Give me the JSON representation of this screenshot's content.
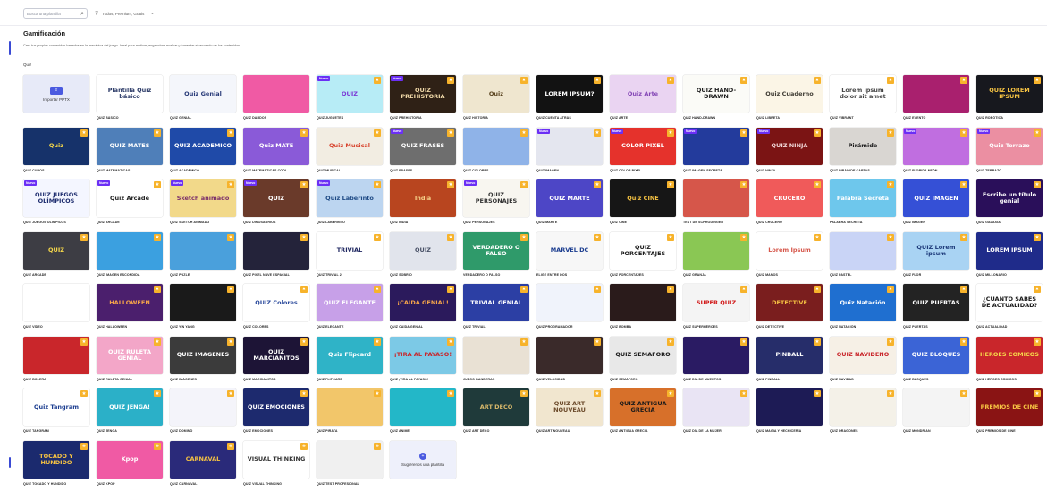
{
  "search": {
    "placeholder": "Busca una plantilla"
  },
  "filter": {
    "label": "Todos, Premium, Gratis"
  },
  "page": {
    "title": "Gamificación",
    "description": "Crea tus propios contenidos basados en la mecánica del juego. Ideal para motivar, enganchar, evaluar y fomentar el recuerdo de los contenidos.",
    "section": "Quiz"
  },
  "cards": [
    {
      "label": "",
      "thumb": "Importar PPTX",
      "bg": "#e7eaf8",
      "fg": "#3f4fd9",
      "kind": "upload"
    },
    {
      "label": "QUIZ BÁSICO",
      "thumb": "Plantilla Quiz básico",
      "bg": "#ffffff",
      "fg": "#2b3a67"
    },
    {
      "label": "QUIZ GENIAL",
      "thumb": "Quiz Genial",
      "bg": "#f4f6fb",
      "fg": "#283a78"
    },
    {
      "label": "QUIZ DARDOS",
      "thumb": "",
      "bg": "#f05aa4",
      "fg": "#ffffff"
    },
    {
      "label": "QUIZ JUGUETES",
      "thumb": "QUIZ",
      "bg": "#b7ecf6",
      "fg": "#7b39d6",
      "new": true,
      "star": true
    },
    {
      "label": "QUIZ PREHISTORIA",
      "thumb": "QUIZ PREHISTORIA",
      "bg": "#2f2116",
      "fg": "#f1d9a8",
      "new": true,
      "star": true
    },
    {
      "label": "QUIZ HISTORIA",
      "thumb": "Quiz",
      "bg": "#efe6cf",
      "fg": "#5a4420",
      "star": true
    },
    {
      "label": "QUIZ CUENTA ATRÁS",
      "thumb": "LOREM IPSUM?",
      "bg": "#121212",
      "fg": "#ffffff",
      "star": true
    },
    {
      "label": "QUIZ ARTE",
      "thumb": "Quiz Arte",
      "bg": "#ead4f2",
      "fg": "#8447b6",
      "star": true
    },
    {
      "label": "QUIZ HAND-DRAWN",
      "thumb": "QUIZ HAND-DRAWN",
      "bg": "#fbfbf7",
      "fg": "#1e1e1e",
      "star": true
    },
    {
      "label": "QUIZ LIBRETA",
      "thumb": "Quiz Cuaderno",
      "bg": "#fbf5e6",
      "fg": "#403d35",
      "star": true
    },
    {
      "label": "QUIZ VIBRANT",
      "thumb": "Lorem ipsum dolor sit amet",
      "bg": "#ffffff",
      "fg": "#444444",
      "star": true
    },
    {
      "label": "QUIZ EVENTO",
      "thumb": "",
      "bg": "#a9206e",
      "fg": "#ffffff",
      "star": true
    },
    {
      "label": "QUIZ ROBÓTICA",
      "thumb": "QUIZ LOREM IPSUM",
      "bg": "#17181e",
      "fg": "#f6c343",
      "star": true
    },
    {
      "label": "QUIZ CUBOS",
      "thumb": "Quiz",
      "bg": "#16326a",
      "fg": "#f6d84a",
      "star": true
    },
    {
      "label": "QUIZ MATEMÁTICAS",
      "thumb": "QUIZ MATES",
      "bg": "#4f7fb9",
      "fg": "#ffffff",
      "star": true
    },
    {
      "label": "QUIZ ACADÉMICO",
      "thumb": "QUIZ ACADÉMICO",
      "bg": "#1f4aa8",
      "fg": "#ffffff",
      "star": true
    },
    {
      "label": "QUIZ MATEMÁTICAS COOL",
      "thumb": "Quiz MATE",
      "bg": "#8a5ad8",
      "fg": "#ffffff",
      "star": true
    },
    {
      "label": "QUIZ MUSICAL",
      "thumb": "Quiz Musical",
      "bg": "#f2ede2",
      "fg": "#d8452f",
      "star": true
    },
    {
      "label": "QUIZ FRASES",
      "thumb": "QUIZ FRASES",
      "bg": "#6e6e6e",
      "fg": "#ffffff",
      "new": true,
      "star": true
    },
    {
      "label": "QUIZ COLORES",
      "thumb": "",
      "bg": "#8fb3e8",
      "fg": "#ffffff",
      "star": true
    },
    {
      "label": "QUIZ IMAGEN",
      "thumb": "",
      "bg": "#e4e6ef",
      "fg": "#333333",
      "new": true,
      "star": true
    },
    {
      "label": "QUIZ COLOR PIXEL",
      "thumb": "COLOR PIXEL",
      "bg": "#e5322c",
      "fg": "#ffffff",
      "new": true,
      "star": true
    },
    {
      "label": "QUIZ IMAGEN SECRETA",
      "thumb": "",
      "bg": "#233b9c",
      "fg": "#ffffff",
      "new": true,
      "star": true
    },
    {
      "label": "QUIZ NINJA",
      "thumb": "QUIZ NINJA",
      "bg": "#7b1414",
      "fg": "#f0d5d5",
      "new": true,
      "star": true
    },
    {
      "label": "QUIZ PIRÁMIDE CARTAS",
      "thumb": "Pirámide",
      "bg": "#d9d6d2",
      "fg": "#1a1a1a",
      "star": true
    },
    {
      "label": "QUIZ FLORIDA NEÓN",
      "thumb": "",
      "bg": "#c06ee0",
      "fg": "#ffffff",
      "new": true,
      "star": true
    },
    {
      "label": "QUIZ TERRAZO",
      "thumb": "Quiz Terrazo",
      "bg": "#eb8fa2",
      "fg": "#ffffff",
      "new": true,
      "star": true
    },
    {
      "label": "QUIZ JUEGOS OLÍMPICOS",
      "thumb": "QUIZ JUEGOS OLÍMPICOS",
      "bg": "#f4f6ff",
      "fg": "#1d2c6e",
      "new": true
    },
    {
      "label": "QUIZ ARCADE",
      "thumb": "Quiz Arcade",
      "bg": "#ffffff",
      "fg": "#222222",
      "new": true,
      "star": true
    },
    {
      "label": "QUIZ SKETCH ANIMADO",
      "thumb": "Sketch animado",
      "bg": "#f2d98a",
      "fg": "#7a2e6a",
      "new": true,
      "star": true
    },
    {
      "label": "QUIZ DINOSAURIOS",
      "thumb": "QUIZ",
      "bg": "#6a3a2a",
      "fg": "#ffffff",
      "new": true,
      "star": true
    },
    {
      "label": "QUIZ LABERINTO",
      "thumb": "Quiz Laberinto",
      "bg": "#bcd5f0",
      "fg": "#1e4a85",
      "new": true,
      "star": true
    },
    {
      "label": "QUIZ INDIA",
      "thumb": "India",
      "bg": "#b8451f",
      "fg": "#f6d28a",
      "star": true
    },
    {
      "label": "QUIZ PERSONAJES",
      "thumb": "QUIZ PERSONAJES",
      "bg": "#f8f6f0",
      "fg": "#333333",
      "new": true,
      "star": true
    },
    {
      "label": "QUIZ MARTE",
      "thumb": "QUIZ MARTE",
      "bg": "#4d46c6",
      "fg": "#ffffff",
      "star": true
    },
    {
      "label": "QUIZ CINE",
      "thumb": "Quiz CINE",
      "bg": "#161616",
      "fg": "#f6c343",
      "star": true
    },
    {
      "label": "TEST DE SCHRÖDINGER",
      "thumb": "",
      "bg": "#d6564a",
      "fg": "#ffffff",
      "star": true
    },
    {
      "label": "QUIZ CRUCERO",
      "thumb": "CRUCERO",
      "bg": "#f05a5a",
      "fg": "#ffffff",
      "star": true
    },
    {
      "label": "PALABRA SECRETA",
      "thumb": "Palabra Secreta",
      "bg": "#6ec7ec",
      "fg": "#ffffff",
      "star": true
    },
    {
      "label": "QUIZ IMAGEN",
      "thumb": "QUIZ IMAGEN",
      "bg": "#3550d6",
      "fg": "#ffffff",
      "star": true
    },
    {
      "label": "QUIZ GALAXIA",
      "thumb": "Escribe un título genial",
      "bg": "#2a0f5a",
      "fg": "#ffffff",
      "star": true
    },
    {
      "label": "QUIZ ARCADE",
      "thumb": "QUIZ",
      "bg": "#3d3d44",
      "fg": "#f6d84a",
      "star": true
    },
    {
      "label": "QUIZ IMAGEN ESCONDIDA",
      "thumb": "",
      "bg": "#3ba0e0",
      "fg": "#ffffff",
      "star": true
    },
    {
      "label": "QUIZ PUZLE",
      "thumb": "",
      "bg": "#4aa0dc",
      "fg": "#ffffff",
      "star": true
    },
    {
      "label": "QUIZ PIXEL NAVE ESPACIAL",
      "thumb": "",
      "bg": "#24233a",
      "fg": "#ffffff",
      "star": true
    },
    {
      "label": "QUIZ TRIVIAL 2",
      "thumb": "TRIVIAL",
      "bg": "#ffffff",
      "fg": "#1e2660",
      "star": true
    },
    {
      "label": "QUIZ SOBRIO",
      "thumb": "QUIZ",
      "bg": "#e1e4ec",
      "fg": "#485066",
      "star": true
    },
    {
      "label": "VERDADERO O FALSO",
      "thumb": "VERDADERO O FALSO",
      "bg": "#2f9a6a",
      "fg": "#ffffff",
      "star": true
    },
    {
      "label": "ELIGE ENTRE DOS",
      "thumb": "MARVEL DC",
      "bg": "#f7f7f7",
      "fg": "#1a3c8f",
      "star": true
    },
    {
      "label": "QUIZ PORCENTAJES",
      "thumb": "QUIZ PORCENTAJES",
      "bg": "#ffffff",
      "fg": "#1a1a1a",
      "star": true
    },
    {
      "label": "QUIZ GRANJA",
      "thumb": "",
      "bg": "#8ac754",
      "fg": "#ffffff",
      "star": true
    },
    {
      "label": "QUIZ MANOS",
      "thumb": "Lorem Ipsum",
      "bg": "#ffffff",
      "fg": "#d6564a",
      "star": true
    },
    {
      "label": "QUIZ PASTEL",
      "thumb": "",
      "bg": "#c9d4f6",
      "fg": "#333333",
      "star": true
    },
    {
      "label": "QUIZ FLOR",
      "thumb": "QUIZ Lorem ipsum",
      "bg": "#a9d3f3",
      "fg": "#1d3a7a",
      "star": true
    },
    {
      "label": "QUIZ MILLONARIO",
      "thumb": "LOREM IPSUM",
      "bg": "#1f2b8a",
      "fg": "#ffffff",
      "star": true
    },
    {
      "label": "QUIZ VÍDEO",
      "thumb": "",
      "bg": "#ffffff",
      "fg": "#222222"
    },
    {
      "label": "QUIZ HALLOWEEN",
      "thumb": "HALLOWEEN",
      "bg": "#4b1f6d",
      "fg": "#f6a54a",
      "star": true
    },
    {
      "label": "QUIZ YIN YANG",
      "thumb": "",
      "bg": "#1a1a1a",
      "fg": "#ffffff",
      "star": true
    },
    {
      "label": "QUIZ COLORES",
      "thumb": "QUIZ Colores",
      "bg": "#ffffff",
      "fg": "#2b4a9c",
      "star": true
    },
    {
      "label": "QUIZ ELEGANTE",
      "thumb": "QUIZ ELEGANTE",
      "bg": "#c7a0e8",
      "fg": "#ffffff",
      "star": true
    },
    {
      "label": "QUIZ CAÍDA GENIAL",
      "thumb": "¡CAÍDA GENIAL!",
      "bg": "#2b1a5c",
      "fg": "#f6a54a",
      "star": true
    },
    {
      "label": "QUIZ TRIVIAL",
      "thumb": "TRIVIAL GENIAL",
      "bg": "#2c3fa4",
      "fg": "#ffffff",
      "star": true
    },
    {
      "label": "QUIZ PROGRAMADOR",
      "thumb": "",
      "bg": "#f0f3fb",
      "fg": "#1b2a6b",
      "star": true
    },
    {
      "label": "QUIZ BOMBA",
      "thumb": "",
      "bg": "#2a1b1b",
      "fg": "#ffffff",
      "star": true
    },
    {
      "label": "QUIZ SUPERHÉROES",
      "thumb": "SUPER QUIZ",
      "bg": "#f4f4f4",
      "fg": "#d11a1a",
      "star": true
    },
    {
      "label": "QUIZ DETECTIVE",
      "thumb": "DETECTIVE",
      "bg": "#7a1e1e",
      "fg": "#f6c343",
      "star": true
    },
    {
      "label": "QUIZ NATACIÓN",
      "thumb": "Quiz Natación",
      "bg": "#1f6fd0",
      "fg": "#ffffff",
      "star": true
    },
    {
      "label": "QUIZ PUERTAS",
      "thumb": "QUIZ PUERTAS",
      "bg": "#232323",
      "fg": "#ffffff",
      "star": true
    },
    {
      "label": "QUIZ ACTUALIDAD",
      "thumb": "¿CUÁNTO SABES DE ACTUALIDAD?",
      "bg": "#ffffff",
      "fg": "#1a1a1a",
      "star": true
    },
    {
      "label": "QUIZ BOLERA",
      "thumb": "",
      "bg": "#c9262b",
      "fg": "#ffffff",
      "star": true
    },
    {
      "label": "QUIZ RULETA GENIAL",
      "thumb": "QUIZ RULETA GENIAL",
      "bg": "#f3a6c8",
      "fg": "#ffffff",
      "star": true
    },
    {
      "label": "QUIZ IMÁGENES",
      "thumb": "QUIZ IMÁGENES",
      "bg": "#3b3b3b",
      "fg": "#ffffff",
      "star": true
    },
    {
      "label": "QUIZ MARCIANITOS",
      "thumb": "QUIZ MARCIANITOS",
      "bg": "#1d1436",
      "fg": "#ffffff",
      "star": true
    },
    {
      "label": "QUIZ FLIPCARD",
      "thumb": "Quiz Flipcard",
      "bg": "#2fb3c7",
      "fg": "#ffffff",
      "star": true
    },
    {
      "label": "QUIZ ¡TIRA AL PAYASO!",
      "thumb": "¡TIRA AL PAYASO!",
      "bg": "#7cc9e6",
      "fg": "#c9262b",
      "star": true
    },
    {
      "label": "JUEGO BANDERAS",
      "thumb": "",
      "bg": "#e9e1d4",
      "fg": "#333333",
      "star": true
    },
    {
      "label": "QUIZ VELOCIDAD",
      "thumb": "",
      "bg": "#3a2a2a",
      "fg": "#ffffff",
      "star": true
    },
    {
      "label": "QUIZ SEMÁFORO",
      "thumb": "QUIZ SEMÁFORO",
      "bg": "#e8e8e8",
      "fg": "#1a1a1a",
      "star": true
    },
    {
      "label": "QUIZ DÍA DE MUERTOS",
      "thumb": "",
      "bg": "#2a1b63",
      "fg": "#f6c343",
      "star": true
    },
    {
      "label": "QUIZ PINBALL",
      "thumb": "PINBALL",
      "bg": "#262d6a",
      "fg": "#ffffff",
      "star": true
    },
    {
      "label": "QUIZ NAVIDAD",
      "thumb": "QUIZ NAVIDEÑO",
      "bg": "#f6f0e6",
      "fg": "#c9262b",
      "star": true
    },
    {
      "label": "QUIZ BLOQUES",
      "thumb": "QUIZ BLOQUES",
      "bg": "#3b64d6",
      "fg": "#ffffff",
      "star": true
    },
    {
      "label": "QUIZ HÉROES CÓMICOS",
      "thumb": "HÉROES CÓMICOS",
      "bg": "#c9262b",
      "fg": "#f6d84a",
      "star": true
    },
    {
      "label": "QUIZ TANGRAM",
      "thumb": "Quiz Tangram",
      "bg": "#ffffff",
      "fg": "#1a3c8f",
      "star": true
    },
    {
      "label": "QUIZ JENGA",
      "thumb": "QUIZ JENGA!",
      "bg": "#2bb0c8",
      "fg": "#ffffff",
      "star": true
    },
    {
      "label": "QUIZ DOMINÓ",
      "thumb": "",
      "bg": "#f4f4fa",
      "fg": "#333333",
      "star": true
    },
    {
      "label": "QUIZ EMOCIONES",
      "thumb": "QUIZ EMOCIONES",
      "bg": "#1d2a6e",
      "fg": "#ffffff",
      "star": true
    },
    {
      "label": "QUIZ PIRATA",
      "thumb": "",
      "bg": "#f2c66a",
      "fg": "#333333",
      "star": true
    },
    {
      "label": "QUIZ ANIME",
      "thumb": "",
      "bg": "#23b7c8",
      "fg": "#ffffff",
      "star": true
    },
    {
      "label": "QUIZ ART DÉCO",
      "thumb": "ART DÉCO",
      "bg": "#1f3a3a",
      "fg": "#d8b86a",
      "star": true
    },
    {
      "label": "QUIZ ART NOUVEAU",
      "thumb": "QUIZ ART NOUVEAU",
      "bg": "#f1e6cf",
      "fg": "#6b4a2a",
      "star": true
    },
    {
      "label": "QUIZ ANTIGUA GRECIA",
      "thumb": "QUIZ ANTIGUA GRECIA",
      "bg": "#d7702a",
      "fg": "#1a1a1a",
      "star": true
    },
    {
      "label": "QUIZ DÍA DE LA MUJER",
      "thumb": "",
      "bg": "#e9e4f4",
      "fg": "#6a2a8a",
      "star": true
    },
    {
      "label": "QUIZ MAGIA Y HECHICERÍA",
      "thumb": "",
      "bg": "#1d1b55",
      "fg": "#f6c343",
      "star": true
    },
    {
      "label": "QUIZ DRAGONES",
      "thumb": "",
      "bg": "#f4f1e8",
      "fg": "#333333",
      "star": true
    },
    {
      "label": "QUIZ MONDRIAN",
      "thumb": "",
      "bg": "#f4f4f4",
      "fg": "#1a3c8f",
      "star": true
    },
    {
      "label": "QUIZ PREMIOS DE CINE",
      "thumb": "PREMIOS DE CINE",
      "bg": "#8a1414",
      "fg": "#f6c343",
      "star": true
    },
    {
      "label": "QUIZ TOCADO Y HUNDIDO",
      "thumb": "TOCADO Y HUNDIDO",
      "bg": "#1b2a6e",
      "fg": "#f6c343",
      "star": true
    },
    {
      "label": "QUIZ KPOP",
      "thumb": "Kpop",
      "bg": "#f05aa4",
      "fg": "#ffffff",
      "star": true
    },
    {
      "label": "QUIZ CARNAVAL",
      "thumb": "CARNAVAL",
      "bg": "#2a2a7a",
      "fg": "#f6c343",
      "star": true
    },
    {
      "label": "QUIZ VISUAL THINKING",
      "thumb": "VISUAL THINKING",
      "bg": "#ffffff",
      "fg": "#333333",
      "star": true
    },
    {
      "label": "QUIZ TEST PROFESIONAL",
      "thumb": "",
      "bg": "#f0f0f0",
      "fg": "#333333",
      "star": true
    },
    {
      "label": "",
      "thumb": "Sugiérenos una plantilla",
      "bg": "#eef0fb",
      "fg": "#333333",
      "kind": "suggest"
    }
  ]
}
